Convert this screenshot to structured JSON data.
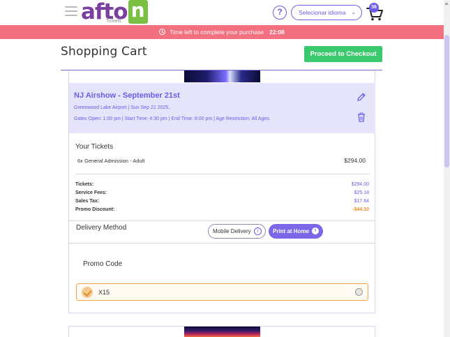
{
  "header": {
    "logo_text": "afto",
    "logo_n": "n",
    "logo_sub": "Tickets",
    "help_symbol": "?",
    "language_label": "Selecionar idioma",
    "cart_count": "36"
  },
  "timer": {
    "label": "Time left to complete your purchase",
    "time": "22:08"
  },
  "page": {
    "title": "Shopping Cart",
    "checkout_label": "Proceed to Checkout"
  },
  "event": {
    "title": "NJ Airshow - September 21st",
    "venue_line": "Greenwood Lake Airport | Sun Sep 21 2025,",
    "details_line": "Gates Open: 1:00 pm | Start Time: 4:30 pm | End Time: 8:00 pm | Age Restriction: All Ages."
  },
  "tickets": {
    "label": "Your Tickets",
    "items": [
      {
        "name": "6x General Admission - Adult",
        "price": "$294.00"
      }
    ]
  },
  "summary": {
    "rows": [
      {
        "label": "Tickets:",
        "value": "$294.00"
      },
      {
        "label": "Service Fees:",
        "value": "$25.18"
      },
      {
        "label": "Sales Tax:",
        "value": "$17.64"
      },
      {
        "label": "Promo Discount:",
        "value": "-$44.10"
      }
    ]
  },
  "delivery": {
    "label": "Delivery Method",
    "options": [
      "Mobile Delivery",
      "Print at Home"
    ],
    "selected": "Print at Home"
  },
  "promo": {
    "label": "Promo Code",
    "value": "X15"
  },
  "colors": {
    "accent": "#6c5ce7",
    "timer_bar": "#f2707f",
    "checkout": "#3cc96d",
    "discount": "#f08a24",
    "logo_purple": "#7b3fa0",
    "logo_green": "#7bc043"
  },
  "icons": [
    "menu-icon",
    "help-icon",
    "chevron-down-icon",
    "cart-icon",
    "clock-icon",
    "edit-icon",
    "trash-icon",
    "info-icon",
    "check-icon",
    "clear-icon"
  ]
}
